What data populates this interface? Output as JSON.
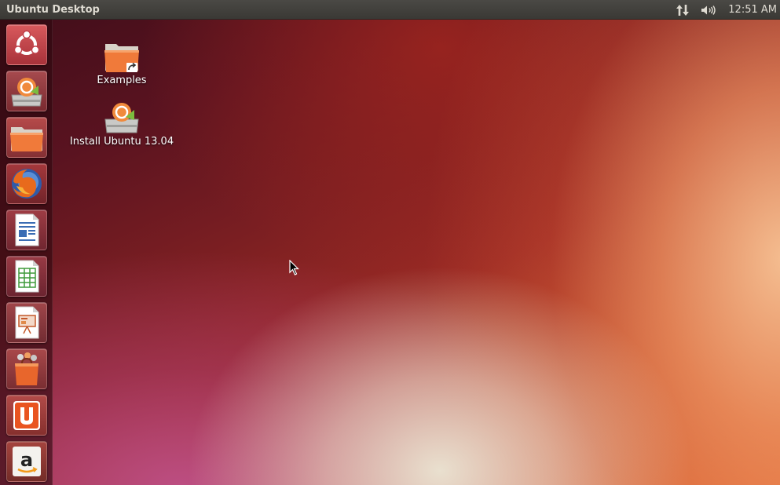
{
  "panel": {
    "title": "Ubuntu Desktop",
    "clock": "12:51 AM"
  },
  "indicators": {
    "network_icon": "network-updown-icon",
    "sound_icon": "speaker-volume-icon"
  },
  "launcher": {
    "items": [
      {
        "name": "dash-home",
        "icon": "ubuntu-logo-icon"
      },
      {
        "name": "install-ubuntu",
        "icon": "ubuntu-installer-icon"
      },
      {
        "name": "files",
        "icon": "folder-icon"
      },
      {
        "name": "firefox",
        "icon": "firefox-icon"
      },
      {
        "name": "libreoffice-writer",
        "icon": "writer-document-icon"
      },
      {
        "name": "libreoffice-calc",
        "icon": "calc-spreadsheet-icon"
      },
      {
        "name": "libreoffice-impress",
        "icon": "impress-presentation-icon"
      },
      {
        "name": "ubuntu-software-center",
        "icon": "shopping-bag-icon"
      },
      {
        "name": "ubuntu-one",
        "icon": "ubuntu-one-icon"
      },
      {
        "name": "amazon",
        "icon": "amazon-icon"
      }
    ]
  },
  "desktop": {
    "icons": [
      {
        "label": "Examples",
        "icon": "folder-link-icon"
      },
      {
        "label": "Install Ubuntu 13.04",
        "icon": "ubuntu-installer-icon"
      }
    ]
  },
  "colors": {
    "panel_bg": "#3c3b37",
    "panel_text": "#dfdbd2",
    "ubuntu_orange": "#e95420",
    "launcher_bg": "#2d080e"
  }
}
